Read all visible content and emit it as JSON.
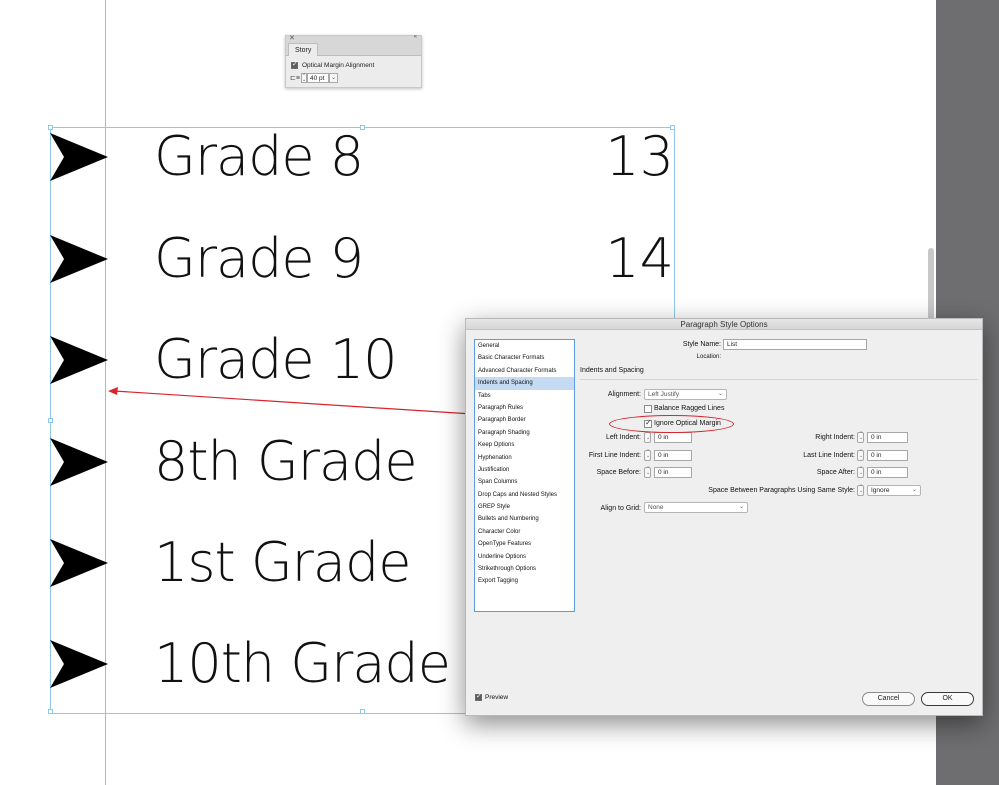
{
  "story_panel": {
    "close_glyph": "✕",
    "collapse_glyph": "«",
    "tab": "Story",
    "optical_margin_label": "Optical Margin Alignment",
    "optical_margin_checked": true,
    "size_value": "40 pt",
    "size_icon": "text-size-icon"
  },
  "canvas_list": [
    {
      "text": "Grade 8",
      "num": "13"
    },
    {
      "text": "Grade 9",
      "num": "14"
    },
    {
      "text": "Grade 10",
      "num": ""
    },
    {
      "text": "8th Grade",
      "num": ""
    },
    {
      "text": "1st Grade",
      "num": ""
    },
    {
      "text": "10th Grade",
      "num": ""
    }
  ],
  "dialog": {
    "title": "Paragraph Style Options",
    "categories": [
      "General",
      "Basic Character Formats",
      "Advanced Character Formats",
      "Indents and Spacing",
      "Tabs",
      "Paragraph Rules",
      "Paragraph Border",
      "Paragraph Shading",
      "Keep Options",
      "Hyphenation",
      "Justification",
      "Span Columns",
      "Drop Caps and Nested Styles",
      "GREP Style",
      "Bullets and Numbering",
      "Character Color",
      "OpenType Features",
      "Underline Options",
      "Strikethrough Options",
      "Export Tagging"
    ],
    "selected_category": "Indents and Spacing",
    "style_name_label": "Style Name:",
    "style_name_value": "List",
    "location_label": "Location:",
    "section_title": "Indents and Spacing",
    "alignment_label": "Alignment:",
    "alignment_value": "Left Justify",
    "balance_ragged_label": "Balance Ragged Lines",
    "balance_ragged_checked": false,
    "ignore_optical_label": "Ignore Optical Margin",
    "ignore_optical_checked": true,
    "left_indent_label": "Left Indent:",
    "left_indent_value": "0 in",
    "right_indent_label": "Right Indent:",
    "right_indent_value": "0 in",
    "first_line_indent_label": "First Line Indent:",
    "first_line_indent_value": "0 in",
    "last_line_indent_label": "Last Line Indent:",
    "last_line_indent_value": "0 in",
    "space_before_label": "Space Before:",
    "space_before_value": "0 in",
    "space_after_label": "Space After:",
    "space_after_value": "0 in",
    "space_between_label": "Space Between Paragraphs Using Same Style:",
    "space_between_value": "Ignore",
    "align_grid_label": "Align to Grid:",
    "align_grid_value": "None",
    "preview_label": "Preview",
    "preview_checked": true,
    "cancel_label": "Cancel",
    "ok_label": "OK"
  },
  "colors": {
    "frame_guide": "#8ec8ec",
    "margin_guide": "#f29aa6",
    "annotation_red": "#d9232d",
    "selection_blue": "#c4dbf3"
  }
}
